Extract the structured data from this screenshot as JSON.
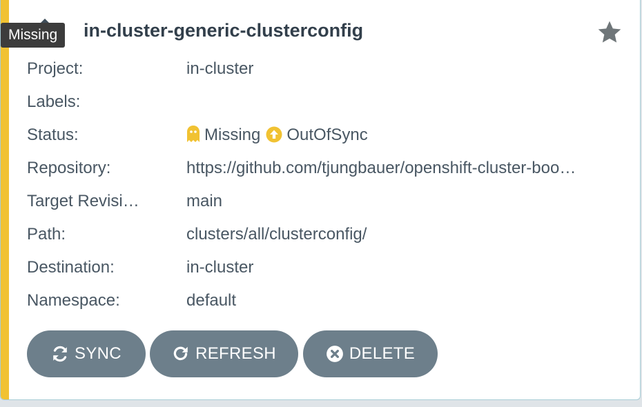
{
  "tooltip": "Missing",
  "app": {
    "title": "in-cluster-generic-clusterconfig",
    "accent_color": "#f1c232"
  },
  "fields": {
    "project": {
      "label": "Project:",
      "value": "in-cluster"
    },
    "labels": {
      "label": "Labels:",
      "value": ""
    },
    "status": {
      "label": "Status:",
      "health": {
        "text": "Missing",
        "icon": "ghost-icon",
        "color": "#f1c232"
      },
      "sync": {
        "text": "OutOfSync",
        "icon": "arrow-up-circle-icon",
        "color": "#f1c232"
      }
    },
    "repository": {
      "label": "Repository:",
      "value": "https://github.com/tjungbauer/openshift-cluster-boo…"
    },
    "target_revision": {
      "label": "Target Revisi…",
      "value": "main"
    },
    "path": {
      "label": "Path:",
      "value": "clusters/all/clusterconfig/"
    },
    "destination": {
      "label": "Destination:",
      "value": "in-cluster"
    },
    "namespace": {
      "label": "Namespace:",
      "value": "default"
    }
  },
  "actions": {
    "sync": "SYNC",
    "refresh": "REFRESH",
    "delete": "DELETE",
    "button_color": "#6d7f8b"
  }
}
